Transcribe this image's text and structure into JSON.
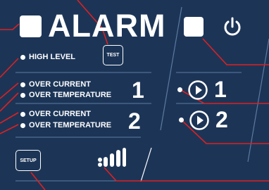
{
  "alarm_panel": {
    "title": "ALARM",
    "test_button_label": "TEST",
    "high_level_label": "HIGH LEVEL",
    "pump1_labels": {
      "over_current": "OVER CURRENT",
      "over_temperature": "OVER TEMPERATURE",
      "number": "1"
    },
    "pump2_labels": {
      "over_current": "OVER CURRENT",
      "over_temperature": "OVER TEMPERATURE",
      "number": "2"
    }
  },
  "pump_panel": {
    "power_icon": "power-icon",
    "pump1_number": "1",
    "pump2_number": "2",
    "run_icon": "play-circle-icon"
  },
  "footer": {
    "setup_button_label": "SETUP",
    "signal_icon": "signal-strength-icon"
  },
  "colors": {
    "background": "#1c3557",
    "foreground": "#ffffff",
    "leader_line": "#e02020",
    "divider": "#5d7aa0"
  }
}
